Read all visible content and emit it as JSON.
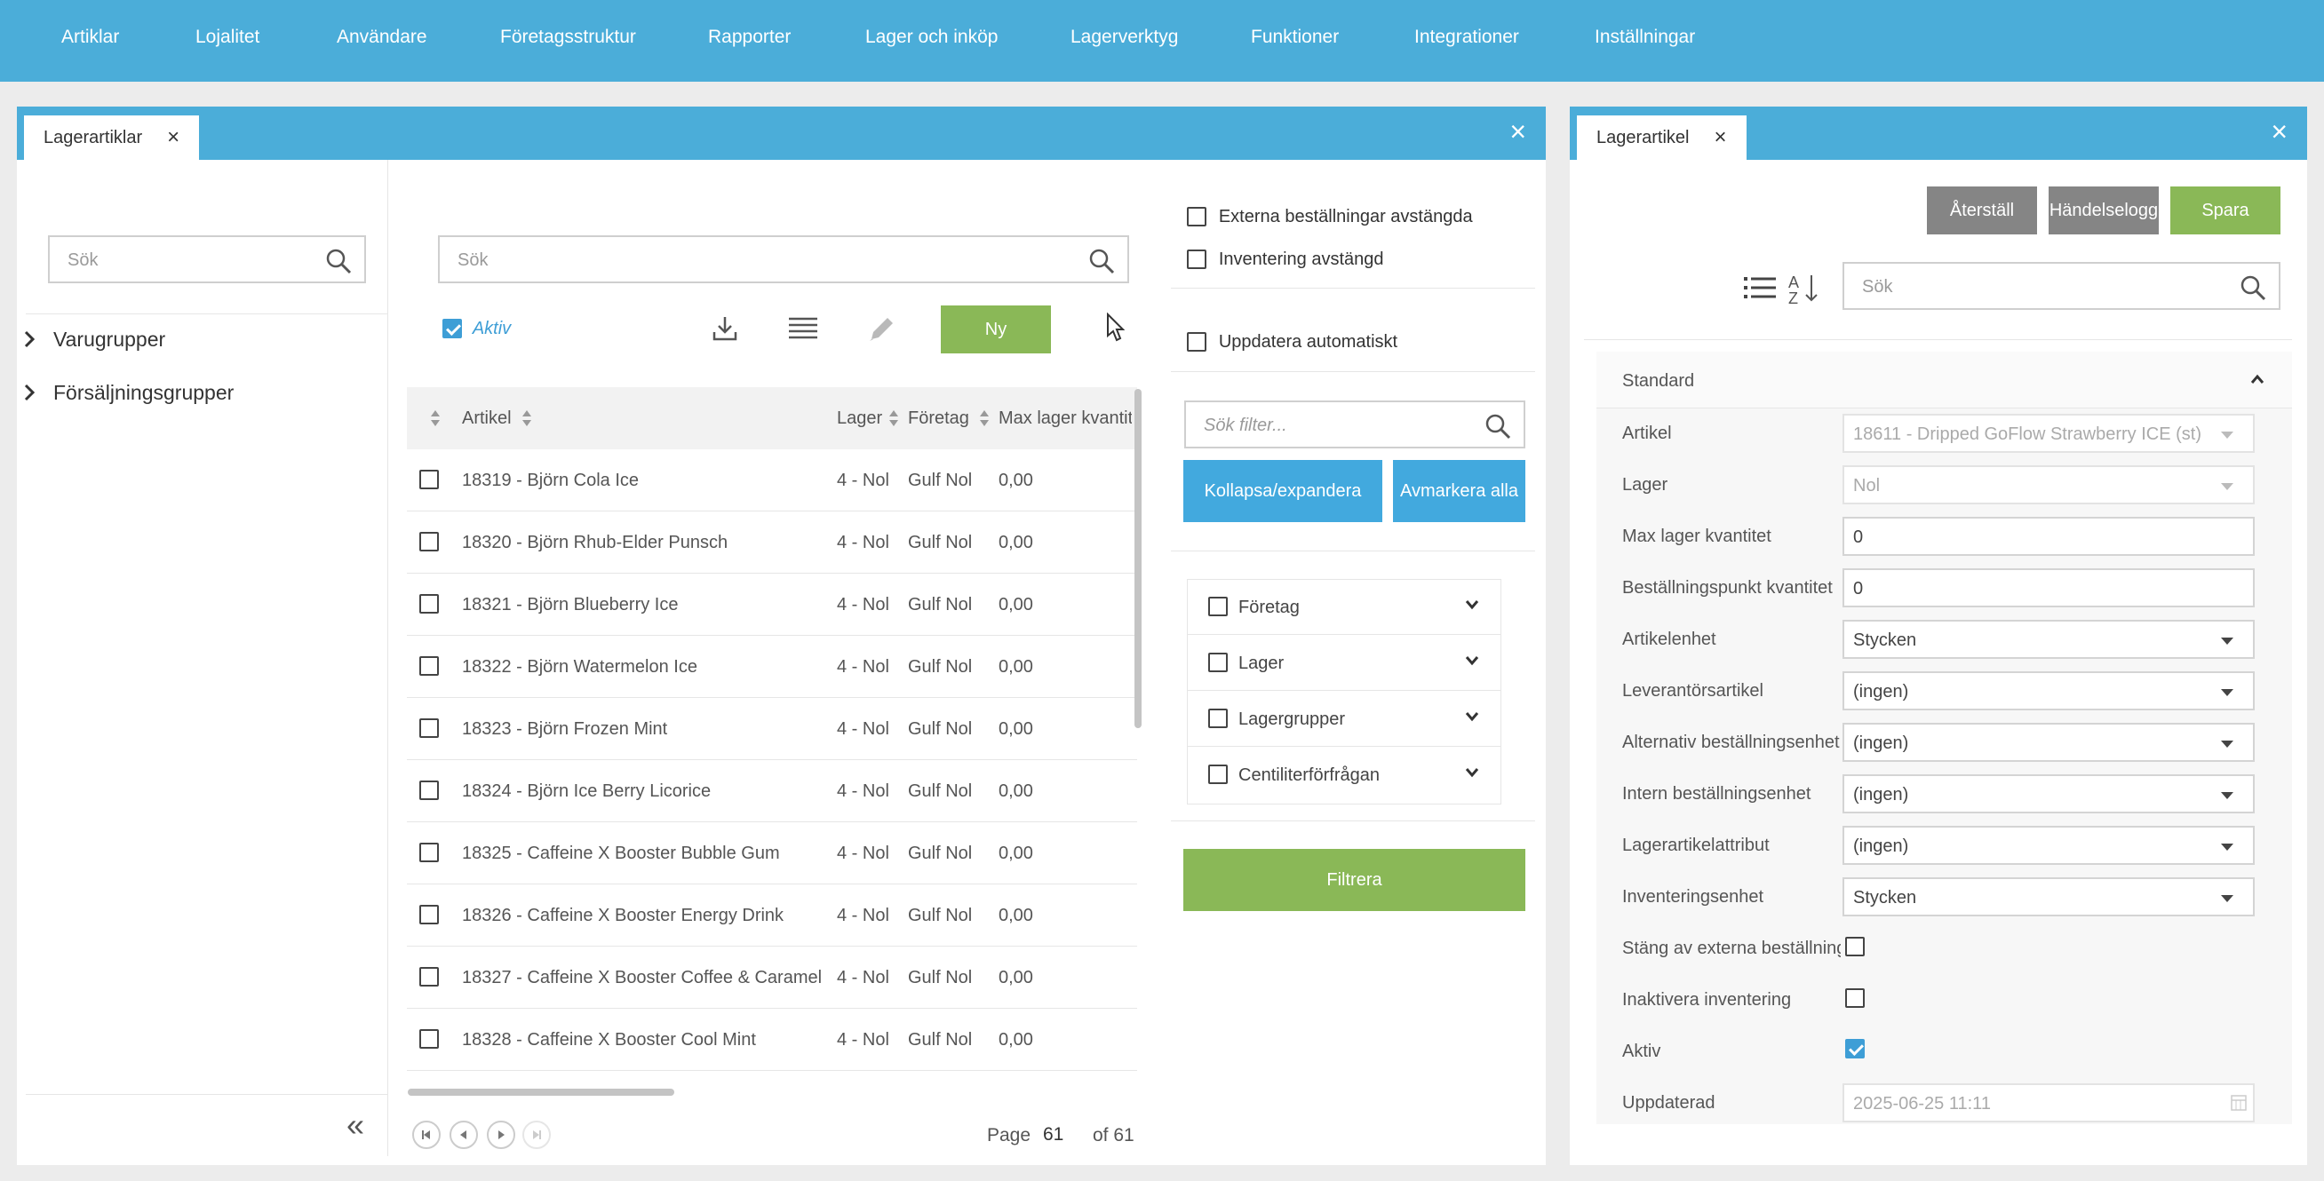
{
  "nav": {
    "items": [
      "Artiklar",
      "Lojalitet",
      "Användare",
      "Företagsstruktur",
      "Rapporter",
      "Lager och inköp",
      "Lagerverktyg",
      "Funktioner",
      "Integrationer",
      "Inställningar"
    ]
  },
  "left_panel": {
    "tab_label": "Lagerartiklar",
    "close_icon": "×",
    "tree_search_placeholder": "Sök",
    "tree_items": [
      "Varugrupper",
      "Försäljningsgrupper"
    ],
    "collapse_icon": "«",
    "grid_search_placeholder": "Sök",
    "aktiv_label": "Aktiv",
    "new_button": "Ny",
    "columns": [
      "Artikel",
      "Lager",
      "Företag",
      "Max lager kvantit"
    ],
    "rows": [
      {
        "artikel": "18319 - Björn Cola Ice",
        "lager": "4 - Nol",
        "foretag": "Gulf Nol",
        "max": "0,00"
      },
      {
        "artikel": "18320 - Björn Rhub-Elder Punsch",
        "lager": "4 - Nol",
        "foretag": "Gulf Nol",
        "max": "0,00"
      },
      {
        "artikel": "18321 - Björn Blueberry Ice",
        "lager": "4 - Nol",
        "foretag": "Gulf Nol",
        "max": "0,00"
      },
      {
        "artikel": "18322 - Björn Watermelon Ice",
        "lager": "4 - Nol",
        "foretag": "Gulf Nol",
        "max": "0,00"
      },
      {
        "artikel": "18323 - Björn Frozen Mint",
        "lager": "4 - Nol",
        "foretag": "Gulf Nol",
        "max": "0,00"
      },
      {
        "artikel": "18324 - Björn Ice Berry Licorice",
        "lager": "4 - Nol",
        "foretag": "Gulf Nol",
        "max": "0,00"
      },
      {
        "artikel": "18325 - Caffeine X Booster Bubble Gum",
        "lager": "4 - Nol",
        "foretag": "Gulf Nol",
        "max": "0,00"
      },
      {
        "artikel": "18326 - Caffeine X Booster Energy Drink",
        "lager": "4 - Nol",
        "foretag": "Gulf Nol",
        "max": "0,00"
      },
      {
        "artikel": "18327 - Caffeine X Booster Coffee & Caramel",
        "lager": "4 - Nol",
        "foretag": "Gulf Nol",
        "max": "0,00"
      },
      {
        "artikel": "18328 - Caffeine X Booster Cool Mint",
        "lager": "4 - Nol",
        "foretag": "Gulf Nol",
        "max": "0,00"
      }
    ],
    "pager": {
      "page_label": "Page",
      "page": "61",
      "of_label": "of 61"
    },
    "filters": {
      "checkboxes": [
        "Externa beställningar avstängda",
        "Inventering avstängd",
        "Uppdatera automatiskt"
      ],
      "search_placeholder": "Sök filter...",
      "collapse_button": "Kollapsa/expandera",
      "unmark_button": "Avmarkera alla",
      "groups": [
        "Företag",
        "Lager",
        "Lagergrupper",
        "Centiliterförfrågan"
      ],
      "filter_button": "Filtrera"
    }
  },
  "right_panel": {
    "tab_label": "Lagerartikel",
    "close_icon": "×",
    "buttons": {
      "reset": "Återställ",
      "log": "Händelselogg",
      "save": "Spara"
    },
    "search_placeholder": "Sök",
    "section_title": "Standard",
    "fields": {
      "artikel": {
        "label": "Artikel",
        "value": "18611 - Dripped GoFlow Strawberry ICE (st)"
      },
      "lager": {
        "label": "Lager",
        "value": "Nol"
      },
      "max": {
        "label": "Max lager kvantitet",
        "value": "0"
      },
      "bestpunkt": {
        "label": "Beställningspunkt kvantitet",
        "value": "0"
      },
      "enhet": {
        "label": "Artikelenhet",
        "value": "Stycken"
      },
      "levart": {
        "label": "Leverantörsartikel",
        "value": "(ingen)"
      },
      "altbest": {
        "label": "Alternativ beställningsenhet",
        "value": "(ingen)"
      },
      "intbest": {
        "label": "Intern beställningsenhet",
        "value": "(ingen)"
      },
      "attribut": {
        "label": "Lagerartikelattribut",
        "value": "(ingen)"
      },
      "invenhet": {
        "label": "Inventeringsenhet",
        "value": "Stycken"
      },
      "stang": {
        "label": "Stäng av externa beställningar"
      },
      "inaktivera": {
        "label": "Inaktivera inventering"
      },
      "aktiv": {
        "label": "Aktiv"
      },
      "uppdaterad": {
        "label": "Uppdaterad",
        "value": "2025-06-25 11:11"
      }
    }
  },
  "colors": {
    "nav": "#4badd9",
    "green": "#8ab857",
    "blue": "#42a9de",
    "gray": "#858585"
  }
}
